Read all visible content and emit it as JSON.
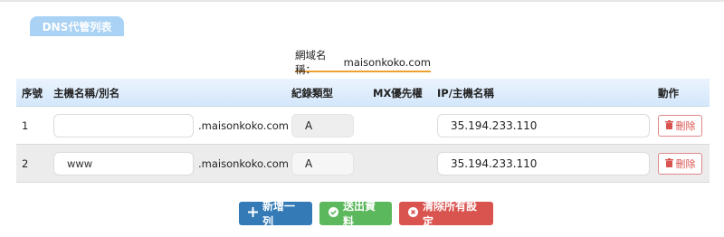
{
  "section_title": "DNS代管列表",
  "domain_caption": {
    "label": "網域名稱：",
    "value": "maisonkoko.com"
  },
  "table": {
    "headers": {
      "seq": "序號",
      "host": "主機名稱/別名",
      "record_type": "紀錄類型",
      "mx_priority": "MX優先權",
      "ip_host": "IP/主機名稱",
      "action": "動作"
    },
    "rows": [
      {
        "seq": "1",
        "host": "",
        "suffix": ".maisonkoko.com",
        "type": "A",
        "mx": "",
        "ip": "35.194.233.110",
        "delete_label": "刪除"
      },
      {
        "seq": "2",
        "host": "www",
        "suffix": ".maisonkoko.com",
        "type": "A",
        "mx": "",
        "ip": "35.194.233.110",
        "delete_label": "刪除"
      }
    ]
  },
  "buttons": {
    "add_row": "新增一列",
    "submit": "送出資料",
    "clear_all": "清除所有設定"
  },
  "icons": {
    "add_row": "plus-icon",
    "submit": "check-circle-icon",
    "clear_all": "times-circle-icon",
    "delete": "trash-icon"
  },
  "colors": {
    "tab": "#a9d2f4",
    "header_bg": "#d4e7fb",
    "caption_underline": "#f0a030",
    "primary": "#337ab7",
    "success": "#5cb85c",
    "danger": "#d9534f"
  }
}
